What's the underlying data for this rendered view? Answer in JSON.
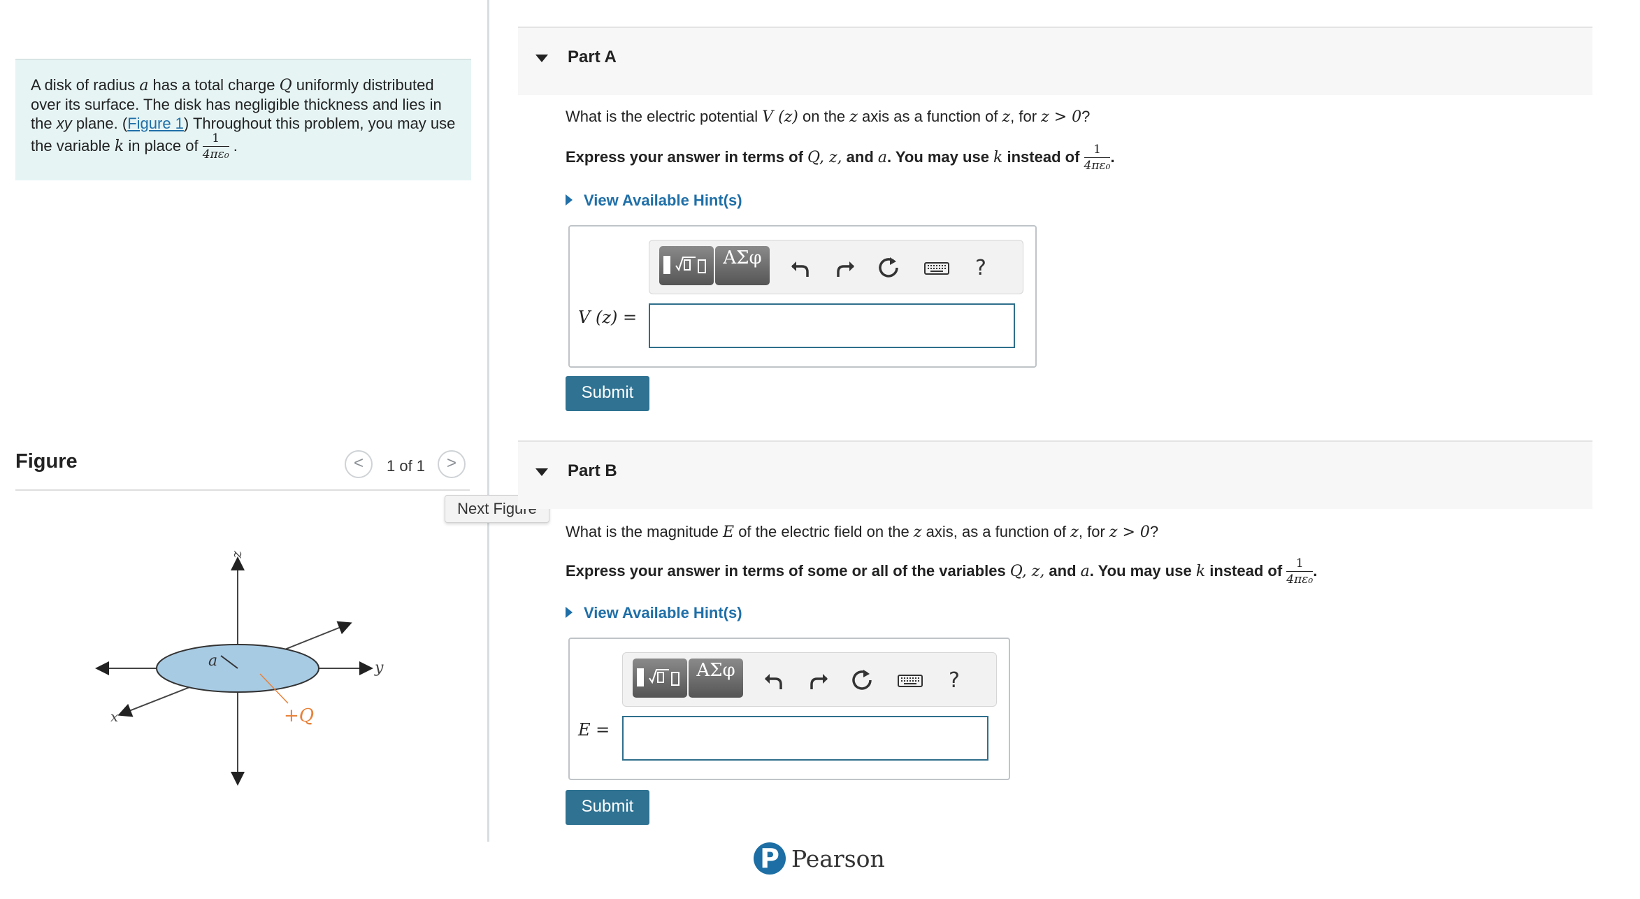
{
  "problem": {
    "text_1": "A disk of radius ",
    "var_a": "a",
    "text_2": " has a total charge ",
    "var_Q": "Q",
    "text_3": " uniformly distributed over its surface. The disk has negligible thickness and lies in the ",
    "xy_italic": "xy",
    "text_4": " plane. (",
    "figure_link": "Figure 1",
    "text_5": ") Throughout this problem, you may use the variable ",
    "var_k": "k",
    "text_6": " in place of ",
    "frac_num": "1",
    "frac_den": "4πε₀",
    "text_end": "."
  },
  "figure": {
    "heading": "Figure",
    "counter": "1 of 1",
    "prev_glyph": "<",
    "next_glyph": ">",
    "tooltip": "Next Figure",
    "label_z": "z",
    "label_y": "y",
    "label_x": "x",
    "label_a": "a",
    "label_charge": "+Q",
    "colors": {
      "disk": "#a8cbe4",
      "charge": "#e8823a"
    }
  },
  "partA": {
    "title": "Part A",
    "question_pre": "What is the electric potential ",
    "question_var": "V (z)",
    "question_mid": " on the ",
    "question_z": "z",
    "question_mid2": " axis as a function of ",
    "question_z2": "z",
    "question_mid3": ", for ",
    "question_cond": "z > 0",
    "question_end": "?",
    "express_pre": "Express your answer in terms of ",
    "express_vars": "Q, z,",
    "express_and": " and ",
    "express_a": "a",
    "express_mid": ". You may use ",
    "express_k": "k",
    "express_post": " instead of ",
    "frac_num": "1",
    "frac_den": "4πε₀",
    "express_end": ".",
    "hint": "View Available Hint(s)",
    "var_label": "V (z) =",
    "input_value": "",
    "submit": "Submit"
  },
  "partB": {
    "title": "Part B",
    "question_pre": "What is the magnitude ",
    "question_var": "E",
    "question_mid": " of the electric field on the ",
    "question_z": "z",
    "question_mid2": " axis, as a function of ",
    "question_z2": "z",
    "question_mid3": ", for ",
    "question_cond": "z > 0",
    "question_end": "?",
    "express_pre": "Express your answer in terms of some or all of the variables ",
    "express_vars": "Q, z,",
    "express_and": " and ",
    "express_a": "a",
    "express_mid": ". You may use ",
    "express_k": "k",
    "express_post": " instead of ",
    "frac_num": "1",
    "frac_den": "4πε₀",
    "express_end": ".",
    "hint": "View Available Hint(s)",
    "var_label": "E =",
    "input_value": "",
    "submit": "Submit"
  },
  "toolbar": {
    "greek_label": "ΑΣφ",
    "help": "?",
    "icons": [
      "templates-icon",
      "greek-symbols-icon",
      "undo-icon",
      "redo-icon",
      "reset-icon",
      "keyboard-icon",
      "help-icon"
    ]
  },
  "footer": {
    "brand": "Pearson",
    "logo_letter": "P"
  }
}
